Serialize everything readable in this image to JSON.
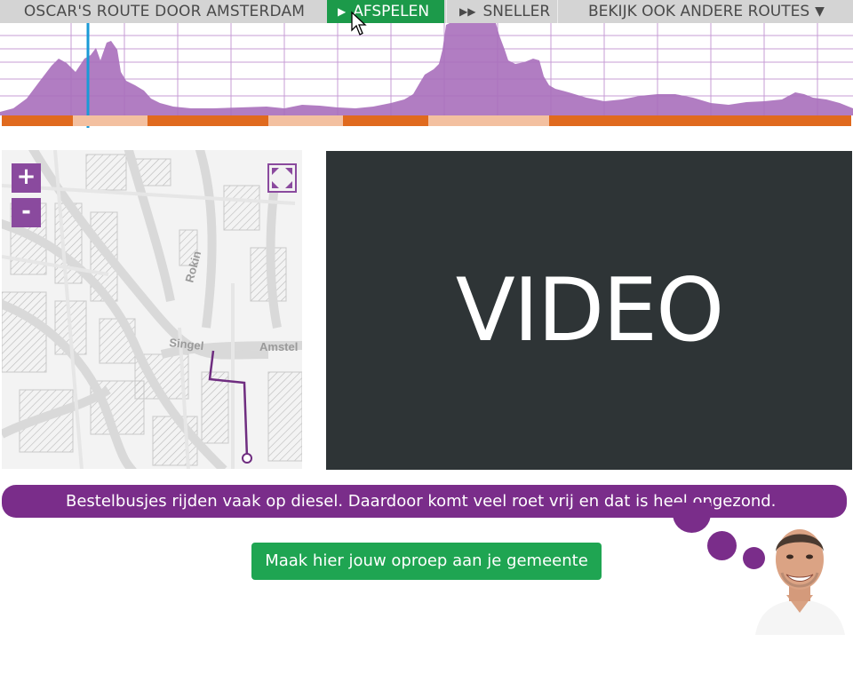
{
  "topbar": {
    "title": "OSCAR'S ROUTE DOOR AMSTERDAM",
    "play": {
      "icon": "play-icon",
      "label": "AFSPELEN"
    },
    "faster": {
      "icon": "fast-forward-icon",
      "label": "SNELLER"
    },
    "other_routes": {
      "label": "BEKIJK OOK ANDERE ROUTES",
      "icon": "caret-down-icon"
    }
  },
  "profile": {
    "fill_color": "#a86fbb",
    "grid_color": "#b57cc9",
    "cursor_color": "#1a9ad6",
    "segment_colors": {
      "dark": "#e06a1e",
      "light": "#f3c0a0"
    }
  },
  "map": {
    "zoom_in_label": "+",
    "zoom_out_label": "-",
    "street_labels": [
      "Rokin",
      "Singel",
      "Amstel"
    ],
    "route_color": "#6f2d80"
  },
  "video": {
    "label": "VIDEO"
  },
  "speech": {
    "text": "Bestelbusjes rijden vaak op diesel. Daardoor komt veel roet vrij en dat is heel ongezond."
  },
  "cta": {
    "label": "Maak hier jouw oproep aan je gemeente"
  },
  "colors": {
    "purple": "#7a2d8a",
    "green": "#1fa552",
    "dark": "#2e3436"
  }
}
